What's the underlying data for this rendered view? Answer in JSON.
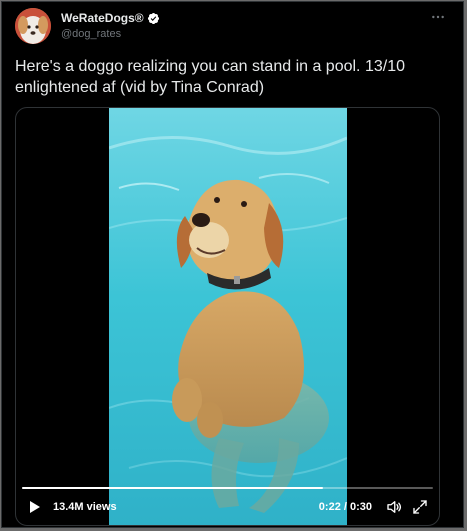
{
  "tweet": {
    "display_name": "WeRateDogs®",
    "handle": "@dog_rates",
    "more_icon": "more-horizontal-icon",
    "text": "Here's a doggo realizing you can stand in a pool. 13/10 enlightened af (vid by Tina Conrad)"
  },
  "video": {
    "views": "13.4M views",
    "time": "0:22 / 0:30",
    "progress": 0.733,
    "icons": {
      "play": "play-icon",
      "volume": "volume-muted-icon",
      "fullscreen": "fullscreen-icon"
    }
  },
  "colors": {
    "background": "#000000",
    "text_primary": "#e7e9ea",
    "text_secondary": "#71767b",
    "border": "#2f3336",
    "verified": "#ffffff",
    "pool": "#35c3d4"
  }
}
